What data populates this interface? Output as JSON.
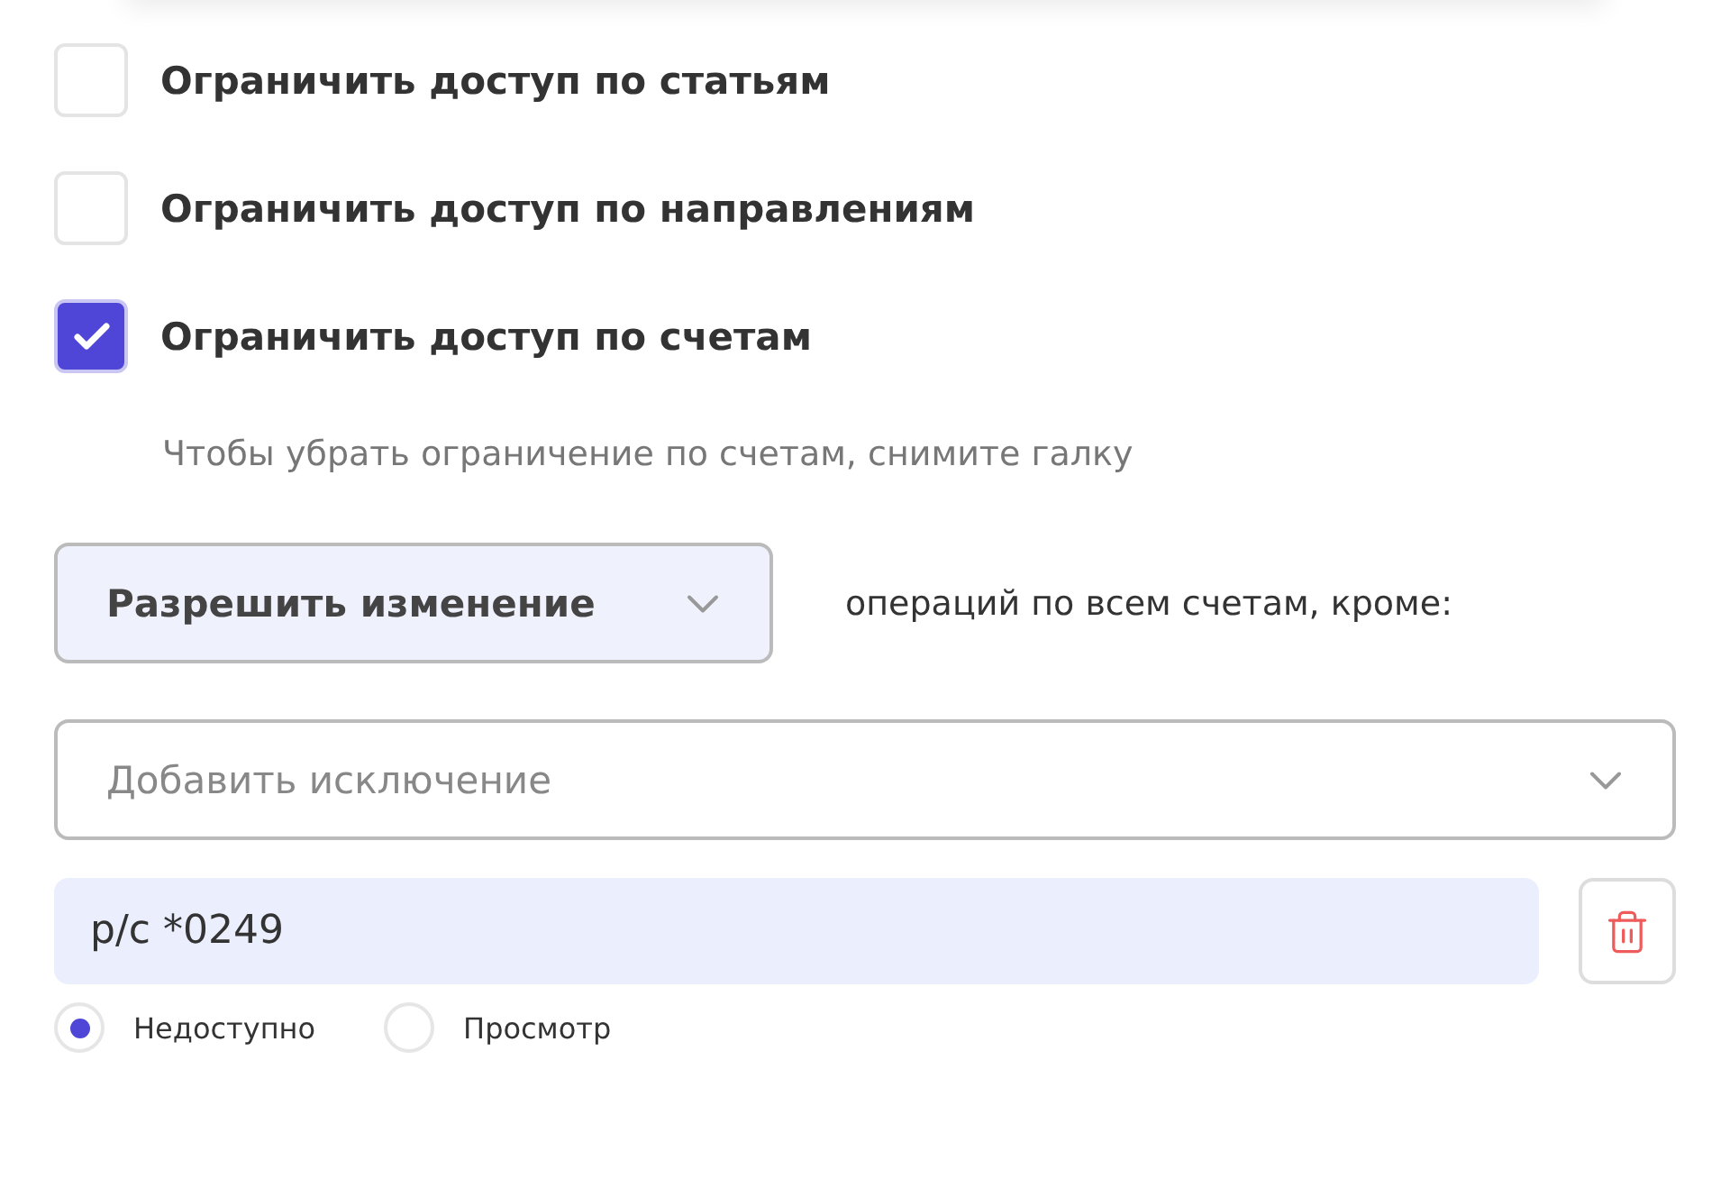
{
  "restrictions": [
    {
      "label": "Ограничить доступ по статьям",
      "checked": false
    },
    {
      "label": "Ограничить доступ по направлениям",
      "checked": false
    },
    {
      "label": "Ограничить доступ по счетам",
      "checked": true
    }
  ],
  "hint": "Чтобы убрать ограничение по счетам, снимите галку",
  "permission": {
    "value": "Разрешить изменение",
    "suffix": "операций по всем счетам, кроме:"
  },
  "exception_select": {
    "placeholder": "Добавить исключение"
  },
  "exceptions": [
    {
      "account": "р/с *0249",
      "modes": [
        {
          "label": "Недоступно",
          "selected": true
        },
        {
          "label": "Просмотр",
          "selected": false
        }
      ]
    }
  ]
}
